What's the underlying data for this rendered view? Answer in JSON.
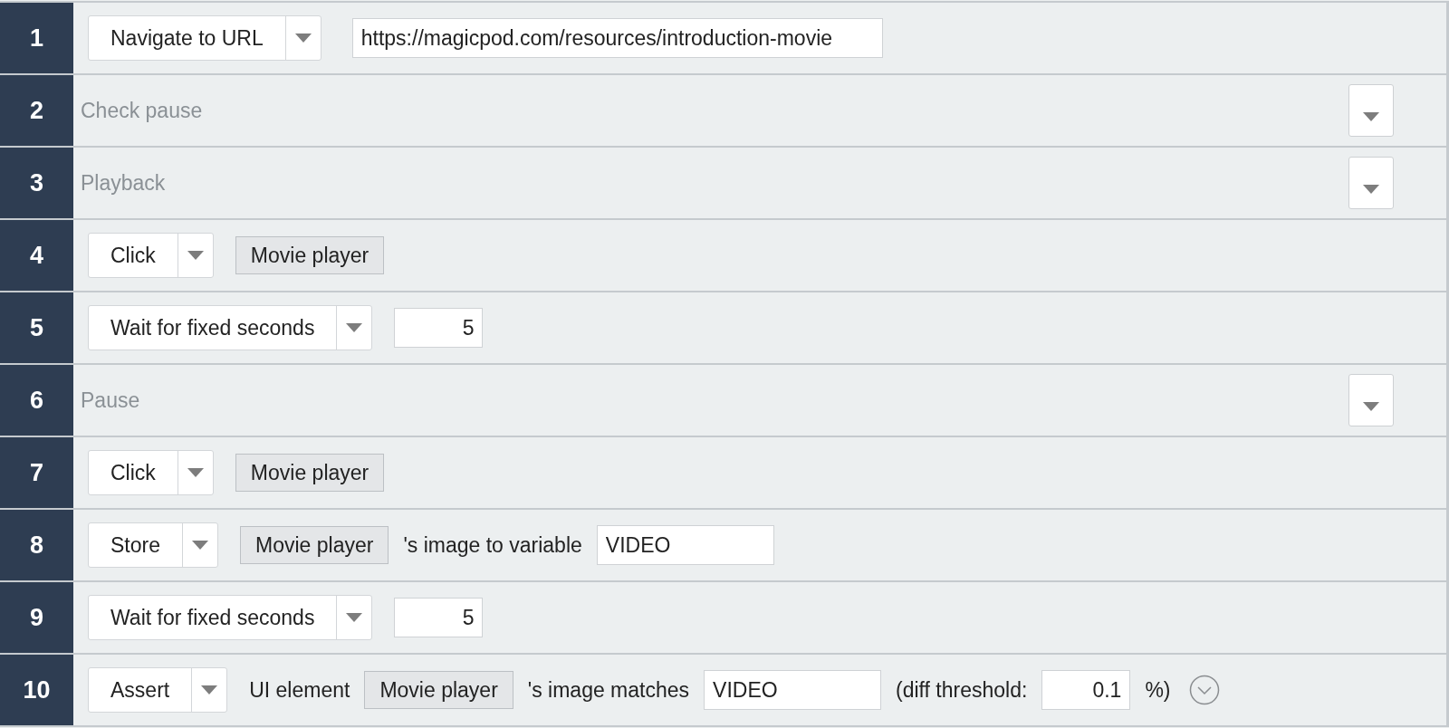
{
  "steps": [
    {
      "number": "1",
      "kind": "command",
      "parts": [
        {
          "kind": "select",
          "label": "Navigate to URL"
        },
        {
          "kind": "url-field",
          "value": "https://magicpod.com/resources/introduction-movie"
        }
      ]
    },
    {
      "number": "2",
      "kind": "comment",
      "text": "Check pause"
    },
    {
      "number": "3",
      "kind": "comment",
      "text": "Playback"
    },
    {
      "number": "4",
      "kind": "command",
      "parts": [
        {
          "kind": "select",
          "label": "Click"
        },
        {
          "kind": "element",
          "label": "Movie player"
        }
      ]
    },
    {
      "number": "5",
      "kind": "command",
      "parts": [
        {
          "kind": "select",
          "label": "Wait for fixed seconds"
        },
        {
          "kind": "number-field",
          "value": "5"
        }
      ]
    },
    {
      "number": "6",
      "kind": "comment",
      "text": "Pause"
    },
    {
      "number": "7",
      "kind": "command",
      "parts": [
        {
          "kind": "select",
          "label": "Click"
        },
        {
          "kind": "element",
          "label": "Movie player"
        }
      ]
    },
    {
      "number": "8",
      "kind": "command",
      "parts": [
        {
          "kind": "select",
          "label": "Store"
        },
        {
          "kind": "element",
          "label": "Movie player"
        },
        {
          "kind": "text",
          "text": "'s image to variable"
        },
        {
          "kind": "text-field",
          "value": "VIDEO"
        }
      ]
    },
    {
      "number": "9",
      "kind": "command",
      "parts": [
        {
          "kind": "select",
          "label": "Wait for fixed seconds"
        },
        {
          "kind": "number-field",
          "value": "5"
        }
      ]
    },
    {
      "number": "10",
      "kind": "command",
      "parts": [
        {
          "kind": "select",
          "label": "Assert"
        },
        {
          "kind": "text",
          "text": "UI element"
        },
        {
          "kind": "element",
          "label": "Movie player"
        },
        {
          "kind": "text",
          "text": "'s image matches"
        },
        {
          "kind": "text-field",
          "value": "VIDEO"
        },
        {
          "kind": "text",
          "text": "(diff threshold:"
        },
        {
          "kind": "number-field",
          "value": "0.1"
        },
        {
          "kind": "text",
          "text": "%)"
        },
        {
          "kind": "expander"
        }
      ]
    }
  ]
}
